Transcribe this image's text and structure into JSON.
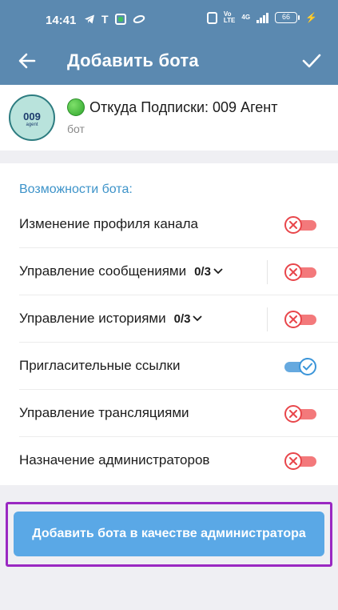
{
  "status_bar": {
    "time": "14:41",
    "battery": "66",
    "network_1": "Vo",
    "network_2": "LTE",
    "network_3": "4G"
  },
  "app_bar": {
    "title": "Добавить бота",
    "back_icon": "arrow-left-icon",
    "confirm_icon": "check-icon"
  },
  "bot": {
    "name": "Откуда Подписки: 009 Агент",
    "subtitle": "бот",
    "avatar_text": "009",
    "avatar_subtext": "agent"
  },
  "permissions": {
    "header": "Возможности бота:",
    "items": [
      {
        "label": "Изменение профиля канала",
        "enabled": false,
        "count": ""
      },
      {
        "label": "Управление сообщениями",
        "enabled": false,
        "count": "0/3"
      },
      {
        "label": "Управление историями",
        "enabled": false,
        "count": "0/3"
      },
      {
        "label": "Пригласительные ссылки",
        "enabled": true,
        "count": ""
      },
      {
        "label": "Управление трансляциями",
        "enabled": false,
        "count": ""
      },
      {
        "label": "Назначение администраторов",
        "enabled": false,
        "count": ""
      }
    ]
  },
  "add_button": {
    "label": "Добавить бота в качестве администратора"
  },
  "colors": {
    "header_bg": "#5b89b0",
    "accent": "#3d93c9",
    "toggle_off": "#e8464b",
    "toggle_on": "#3b95d9",
    "highlight_border": "#9a28c2",
    "button_bg": "#5aa8e6"
  }
}
